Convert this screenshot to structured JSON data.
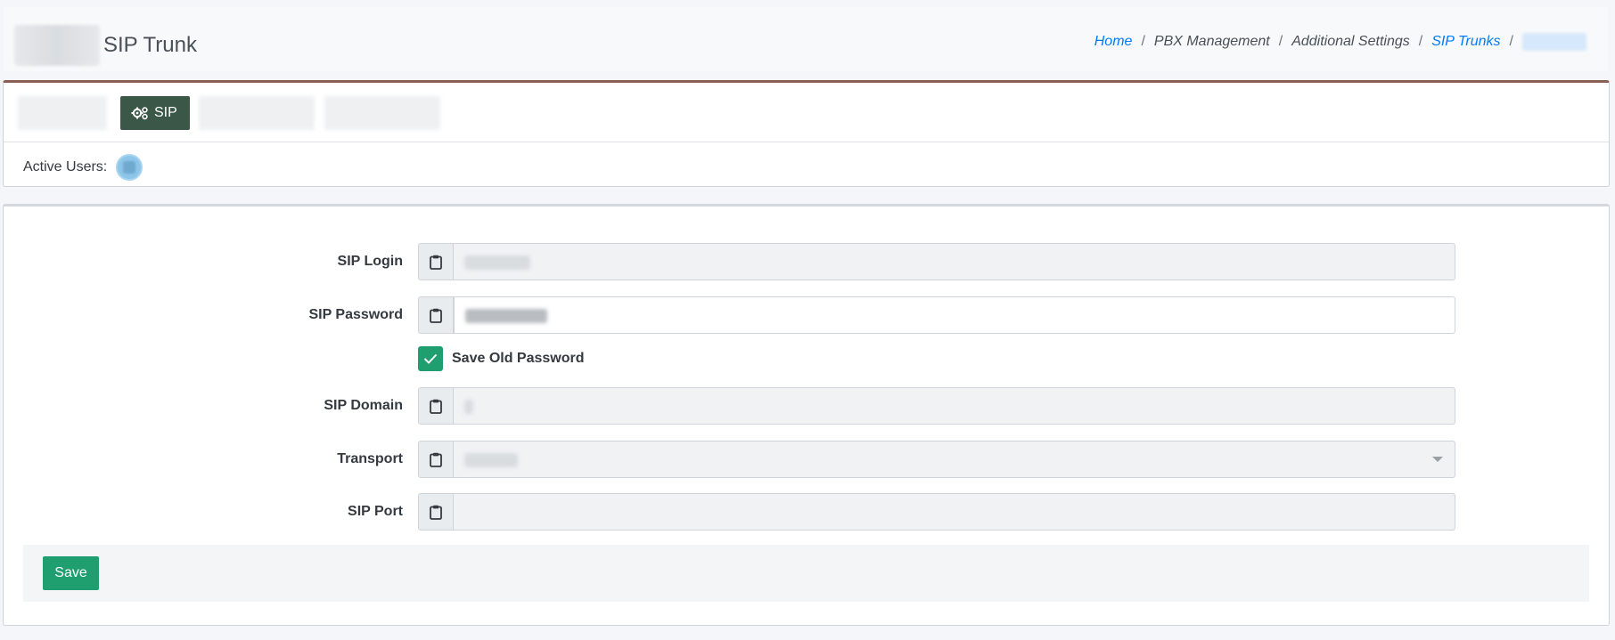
{
  "header": {
    "title": "SIP Trunk",
    "breadcrumb": [
      {
        "label": "Home",
        "link": true
      },
      {
        "label": "PBX Management",
        "link": false
      },
      {
        "label": "Additional Settings",
        "link": false
      },
      {
        "label": "SIP Trunks",
        "link": true
      }
    ]
  },
  "tabs": {
    "active_label": "SIP"
  },
  "active_users": {
    "label": "Active Users:"
  },
  "form": {
    "sip_login_label": "SIP Login",
    "sip_password_label": "SIP Password",
    "save_old_password_label": "Save Old Password",
    "save_old_password_checked": true,
    "sip_domain_label": "SIP Domain",
    "transport_label": "Transport",
    "sip_port_label": "SIP Port",
    "sip_port_value": ""
  },
  "footer": {
    "save_label": "Save"
  },
  "colors": {
    "accent_green": "#1f9e6f",
    "active_tab": "#3b5747",
    "link_blue": "#007bff",
    "card_top_border": "#8b5e52"
  },
  "icons": {
    "field_addon": "clipboard-icon",
    "active_tab": "gears-icon",
    "checkbox": "check-icon"
  }
}
